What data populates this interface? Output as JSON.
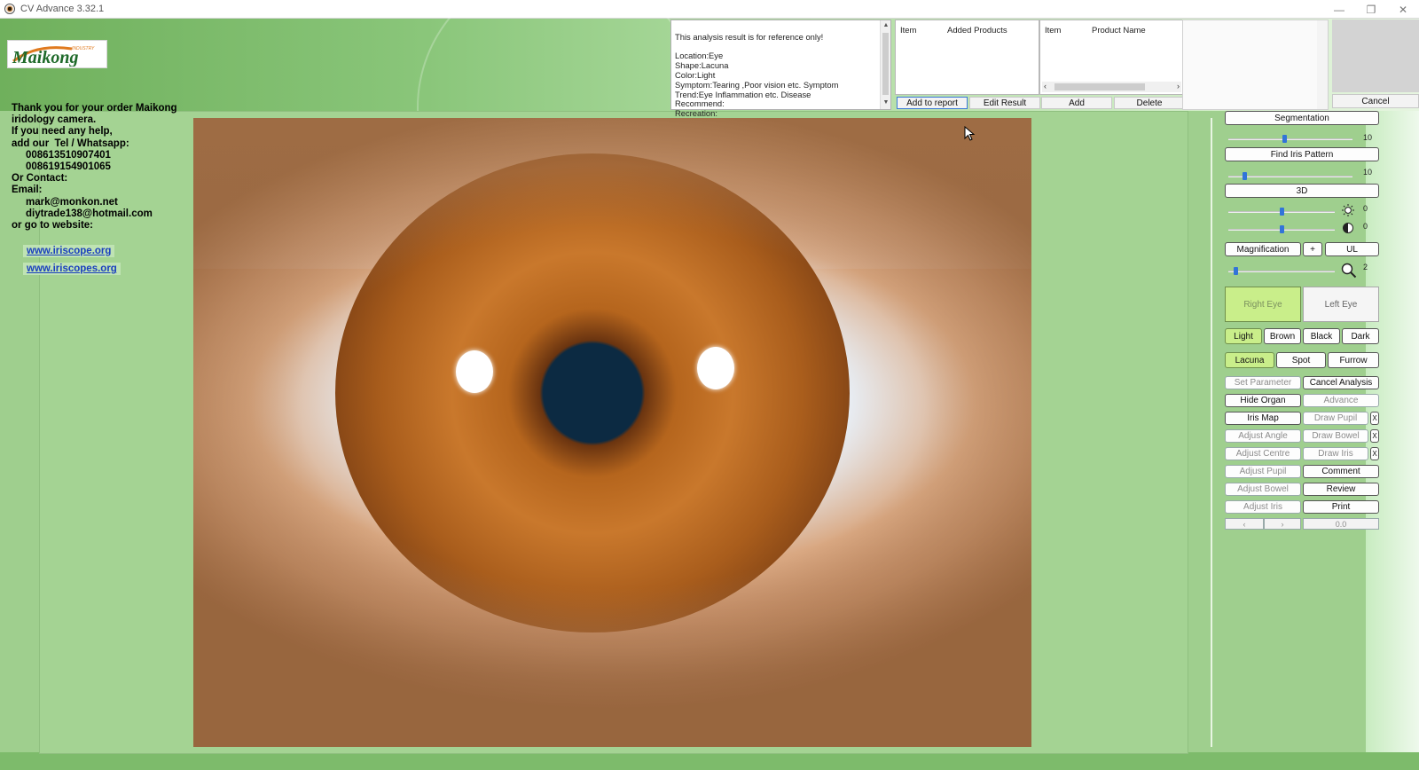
{
  "window": {
    "title": "CV Advance 3.32.1",
    "minimize": "—",
    "restore": "❐",
    "close": "✕"
  },
  "logo": {
    "text": "Maikong",
    "tagline": "INDUSTRY"
  },
  "info": {
    "text": "Thank you for your order Maikong\niridology camera.\nIf you need any help,\nadd our  Tel / Whatsapp:\n     008613510907401\n     008619154901065\nOr Contact:\nEmail:\n     mark@monkon.net\n     diytrade138@hotmail.com\nor go to website:",
    "links": [
      "www.iriscope.org",
      "www.iriscopes.org"
    ]
  },
  "analysis": {
    "text": "This analysis result is for reference only!\n\nLocation:Eye\nShape:Lacuna\nColor:Light\nSymptom:Tearing ,Poor vision etc. Symptom\nTrend:Eye Inflammation etc. Disease\nRecommend:\nRecreation:"
  },
  "added_products": {
    "headers": [
      "Item",
      "Added Products"
    ],
    "buttons": [
      "Add to report",
      "Edit Result"
    ]
  },
  "products": {
    "headers": [
      "Item",
      "Product Name"
    ],
    "buttons": [
      "Add",
      "Delete"
    ]
  },
  "cancel_label": "Cancel",
  "controls": {
    "segmentation": "Segmentation",
    "segmentation_value": "10",
    "segmentation_level": 0.45,
    "find_iris_pattern": "Find Iris Pattern",
    "pattern_value": "10",
    "pattern_level": 0.12,
    "threed": "3D",
    "brightness_value": "0",
    "brightness_level": 0.5,
    "contrast_value": "0",
    "contrast_level": 0.5,
    "magnification": "Magnification",
    "plus": "+",
    "ul": "UL",
    "zoom_value": "2",
    "zoom_level": 0.05,
    "right_eye": "Right Eye",
    "left_eye": "Left Eye",
    "colors": [
      "Light",
      "Brown",
      "Black",
      "Dark"
    ],
    "shapes": [
      "Lacuna",
      "Spot",
      "Furrow"
    ],
    "set_parameter": "Set Parameter",
    "cancel_analysis": "Cancel Analysis",
    "hide_organ": "Hide Organ",
    "advance": "Advance",
    "iris_map": "Iris Map",
    "draw_pupil": "Draw Pupil",
    "adjust_angle": "Adjust Angle",
    "draw_bowel": "Draw Bowel",
    "adjust_centre": "Adjust Centre",
    "draw_iris": "Draw Iris",
    "adjust_pupil": "Adjust Pupil",
    "comment": "Comment",
    "adjust_bowel": "Adjust Bowel",
    "review": "Review",
    "adjust_iris": "Adjust Iris",
    "print": "Print",
    "x": "X",
    "prev": "‹",
    "next": "›",
    "page_value": "0.0"
  },
  "colors": {
    "accent_green": "#c9ee8a",
    "slider_blue": "#3274d9",
    "link_blue": "#1a3fbf"
  }
}
